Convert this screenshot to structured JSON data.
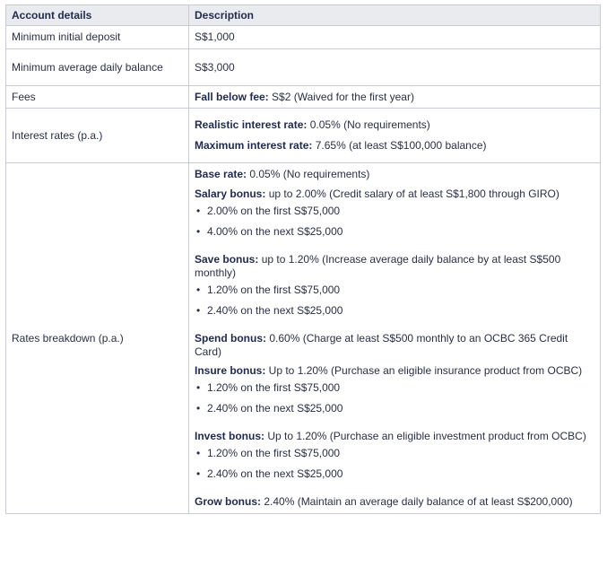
{
  "table": {
    "headers": [
      "Account details",
      "Description"
    ],
    "min_deposit": {
      "label": "Minimum initial deposit",
      "value": "S$1,000"
    },
    "min_avg": {
      "label": "Minimum average daily balance",
      "value": "S$3,000"
    },
    "fees": {
      "label": "Fees",
      "bold": "Fall below fee:",
      "text": " S$2 (Waived for the first year)"
    },
    "interest": {
      "label": "Interest rates (p.a.)",
      "realistic_bold": "Realistic interest rate:",
      "realistic_text": " 0.05% (No requirements)",
      "max_bold": "Maximum interest rate:",
      "max_text": " 7.65% (at least S$100,000 balance)"
    },
    "breakdown": {
      "label": "Rates breakdown (p.a.)",
      "base_bold": "Base rate:",
      "base_text": " 0.05% (No requirements)",
      "salary_bold": "Salary bonus:",
      "salary_text": " up to 2.00% (Credit salary of at least S$1,800 through GIRO)",
      "salary_items": [
        "2.00% on the first S$75,000",
        "4.00% on the next S$25,000"
      ],
      "save_bold": "Save bonus:",
      "save_text": " up to 1.20% (Increase average daily balance by at least S$500 monthly)",
      "save_items": [
        "1.20% on the first S$75,000",
        "2.40% on the next S$25,000"
      ],
      "spend_bold": "Spend bonus:",
      "spend_text": " 0.60% (Charge at least S$500 monthly to an OCBC 365 Credit Card)",
      "insure_bold": "Insure bonus:",
      "insure_text": " Up to 1.20% (Purchase an eligible insurance product from OCBC)",
      "insure_items": [
        "1.20% on the first S$75,000",
        "2.40% on the next S$25,000"
      ],
      "invest_bold": "Invest bonus:",
      "invest_text": " Up to 1.20% (Purchase an eligible investment product from OCBC)",
      "invest_items": [
        "1.20% on the first S$75,000",
        "2.40% on the next S$25,000"
      ],
      "grow_bold": "Grow bonus:",
      "grow_text": " 2.40% (Maintain an average daily balance of at least S$200,000)"
    }
  }
}
